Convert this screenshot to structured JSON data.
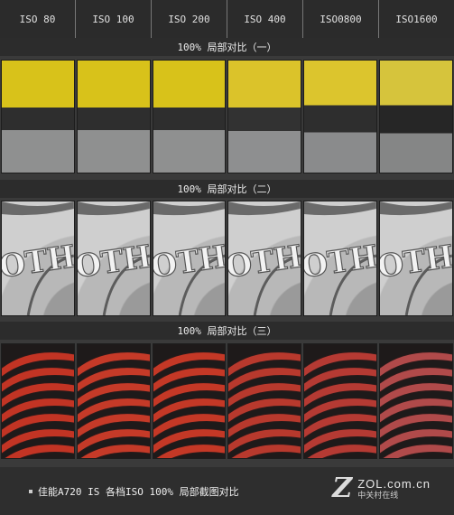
{
  "header": {
    "iso_labels": [
      "ISO 80",
      "ISO 100",
      "ISO 200",
      "ISO 400",
      "ISO0800",
      "ISO1600"
    ]
  },
  "sections": [
    {
      "title": "100% 局部对比（一）"
    },
    {
      "title": "100% 局部对比（二）"
    },
    {
      "title": "100% 局部对比（三）"
    }
  ],
  "footer": {
    "caption": "佳能A720 IS 各档ISO 100% 局部截图对比"
  },
  "logo": {
    "mark": "Z",
    "main": "ZOL.com.cn",
    "sub": "中关村在线"
  },
  "colors": {
    "background": "#3a3a3a",
    "header_bg": "#2b2b2b",
    "yellow": "#d8c21a",
    "feather_red": "#c43a2a"
  }
}
